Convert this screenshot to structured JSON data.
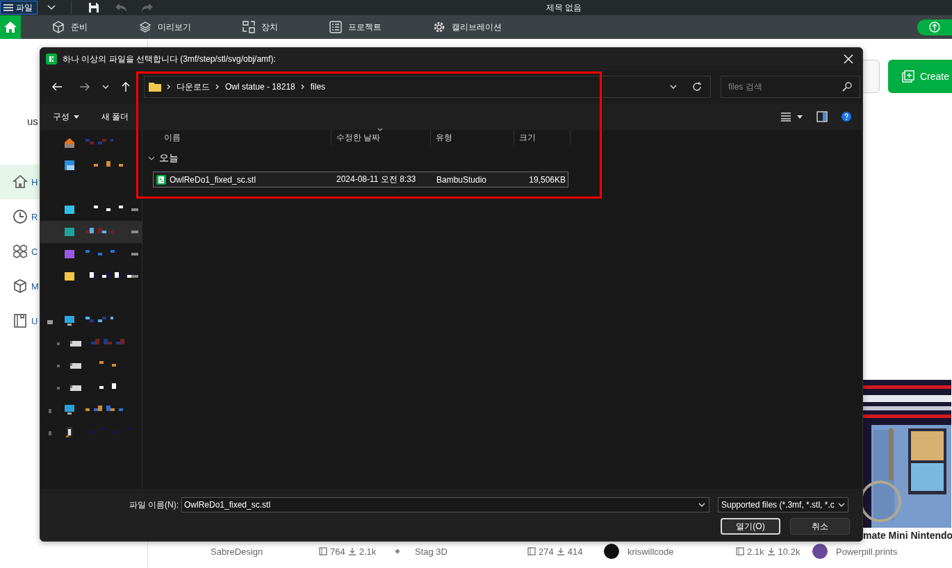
{
  "top_bar": {
    "menu_button": "파일",
    "title": "제목 없음"
  },
  "nav_tabs": [
    {
      "label": "준비",
      "kind": "prepare"
    },
    {
      "label": "미리보기",
      "kind": "preview"
    },
    {
      "label": "장치",
      "kind": "device"
    },
    {
      "label": "프로젝트",
      "kind": "project"
    },
    {
      "label": "캘리브레이션",
      "kind": "calibration"
    }
  ],
  "sidebar": {
    "user_text": "us",
    "items": [
      {
        "label": "H",
        "kind": "home",
        "selected": true
      },
      {
        "label": "R",
        "kind": "recent",
        "selected": false
      },
      {
        "label": "C",
        "kind": "cubes",
        "selected": false
      },
      {
        "label": "M",
        "kind": "model",
        "selected": false
      },
      {
        "label": "U",
        "kind": "manual",
        "selected": false
      }
    ]
  },
  "create_button": "Create",
  "cards": [
    {
      "author": "SabreDesign",
      "likes": "764",
      "downloads": "2.1k"
    },
    {
      "author": "Stag 3D",
      "color": "#8a8a8a",
      "likes": "274",
      "downloads": "414"
    },
    {
      "author": "kriswillcode",
      "color": "#111111",
      "likes": "2.1k",
      "downloads": "10.2k"
    },
    {
      "kind": "picture",
      "title": "mate Mini Nintendo",
      "author": "Powerpill.prints",
      "color": "#6a4a9a"
    }
  ],
  "dialog": {
    "title": "하나 이상의 파일을 선택합니다 (3mf/step/stl/svg/obj/amf):",
    "path": [
      "다운로드",
      "Owl statue - 18218",
      "files"
    ],
    "search": {
      "placeholder": "files 검색"
    },
    "commands": [
      {
        "label": "구성",
        "kind": "menu"
      },
      {
        "label": "새 폴더",
        "kind": "plain"
      }
    ],
    "nav_pane": [
      {
        "kind": "home",
        "color": "#e8731c",
        "pinned": false,
        "selected": false
      },
      {
        "kind": "gallery",
        "color": "#2d8be0",
        "pinned": false,
        "selected": false
      },
      {
        "kind": "folder",
        "color": "#33c0e8",
        "pinned": true,
        "selected": false
      },
      {
        "kind": "folder",
        "color": "#1fa39a",
        "pinned": true,
        "selected": true
      },
      {
        "kind": "folder",
        "color": "#9b59e8",
        "pinned": true,
        "selected": false
      },
      {
        "kind": "folder",
        "color": "#f5c542",
        "pinned": true,
        "selected": false
      },
      {
        "kind": "pc",
        "color": "#29a8e0",
        "pinned": false,
        "selected": false,
        "expanded": true,
        "children": [
          {
            "kind": "drive",
            "color": "#d8d8d8",
            "pinned": false,
            "selected": false
          },
          {
            "kind": "drive",
            "color": "#d8d8d8",
            "pinned": false,
            "selected": false
          },
          {
            "kind": "drive",
            "color": "#d8d8d8",
            "pinned": false,
            "selected": false
          }
        ]
      },
      {
        "kind": "network",
        "color": "#2a9fd8",
        "pinned": false,
        "selected": false,
        "expanded": false
      },
      {
        "kind": "linux",
        "color": "#e8e8e8",
        "pinned": false,
        "selected": false,
        "expanded": false
      }
    ],
    "columns": [
      {
        "label": "이름",
        "sorted": false
      },
      {
        "label": "수정한 날짜",
        "sorted": true
      },
      {
        "label": "유형",
        "sorted": false
      },
      {
        "label": "크기",
        "sorted": false
      }
    ],
    "groups": [
      {
        "label": "오늘",
        "expanded": true,
        "files": [
          {
            "name": "OwlReDo1_fixed_sc.stl",
            "modified": "2024-08-11 오전 8:33",
            "type": "BambuStudio",
            "size": "19,506KB",
            "selected": true
          }
        ]
      }
    ],
    "file_name": {
      "label": "파일 이름(N):",
      "value": "OwlReDo1_fixed_sc.stl"
    },
    "filter": {
      "value": "Supported files (*.3mf, *.stl, *.c"
    },
    "buttons": [
      {
        "label": "열기(O)",
        "default": true
      },
      {
        "label": "취소",
        "default": false
      }
    ]
  }
}
